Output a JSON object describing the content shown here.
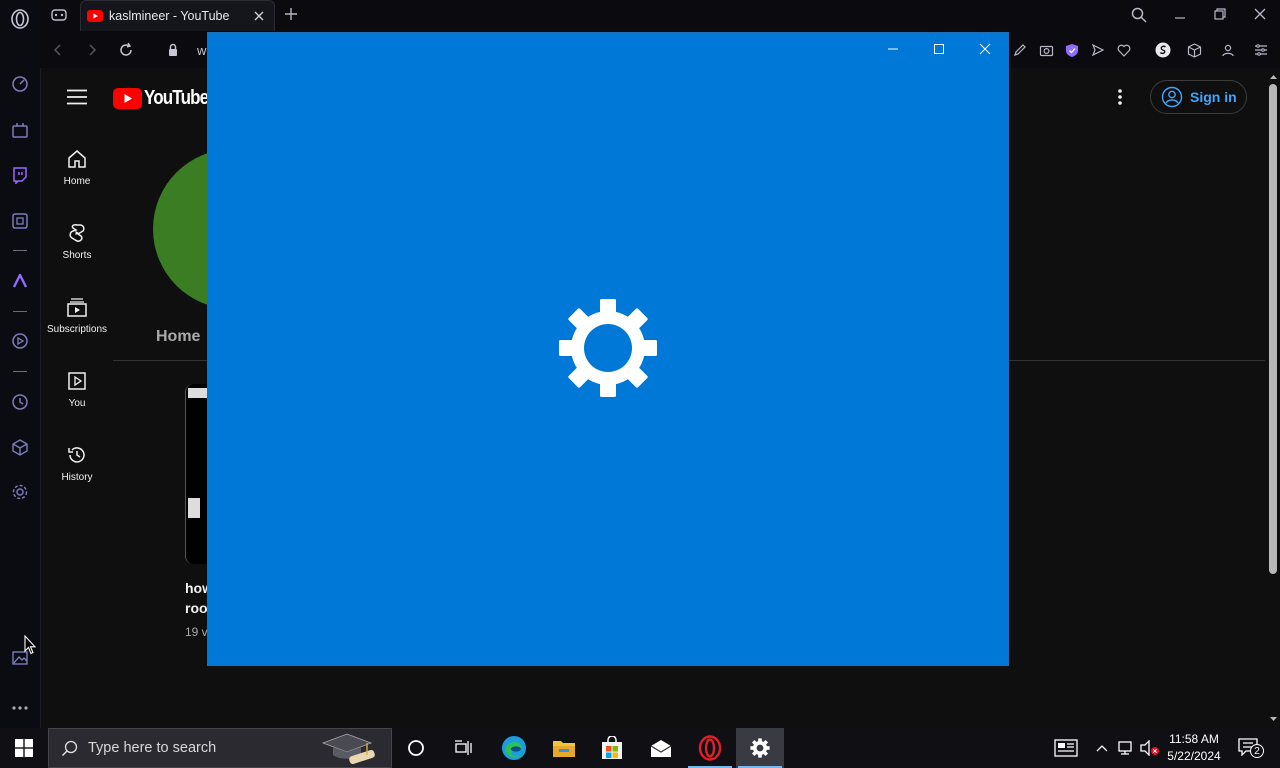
{
  "browser": {
    "tab_title": "kaslmineer - YouTube",
    "url_partial": "w"
  },
  "youtube": {
    "logo_text": "YouTube",
    "sign_in_label": "Sign in",
    "channel_tab": "Home",
    "nav": [
      {
        "label": "Home",
        "icon": "home-icon"
      },
      {
        "label": "Shorts",
        "icon": "shorts-icon"
      },
      {
        "label": "Subscriptions",
        "icon": "subscriptions-icon"
      },
      {
        "label": "You",
        "icon": "you-icon"
      },
      {
        "label": "History",
        "icon": "history-icon"
      }
    ],
    "video": {
      "title_line1": "how",
      "title_line2": "root",
      "meta": "19 v"
    },
    "colors": {
      "brand": "#ff0000",
      "accent": "#3ea6ff",
      "avatar": "#3b7d23"
    }
  },
  "settings_window": {
    "background": "#0078d7",
    "icon": "gear-icon"
  },
  "taskbar": {
    "search_placeholder": "Type here to search",
    "time": "11:58 AM",
    "date": "5/22/2024",
    "notification_count": "2",
    "apps": [
      "cortana-icon",
      "task-view-icon",
      "edge-icon",
      "file-explorer-icon",
      "store-icon",
      "mail-icon",
      "opera-icon",
      "settings-icon"
    ]
  }
}
